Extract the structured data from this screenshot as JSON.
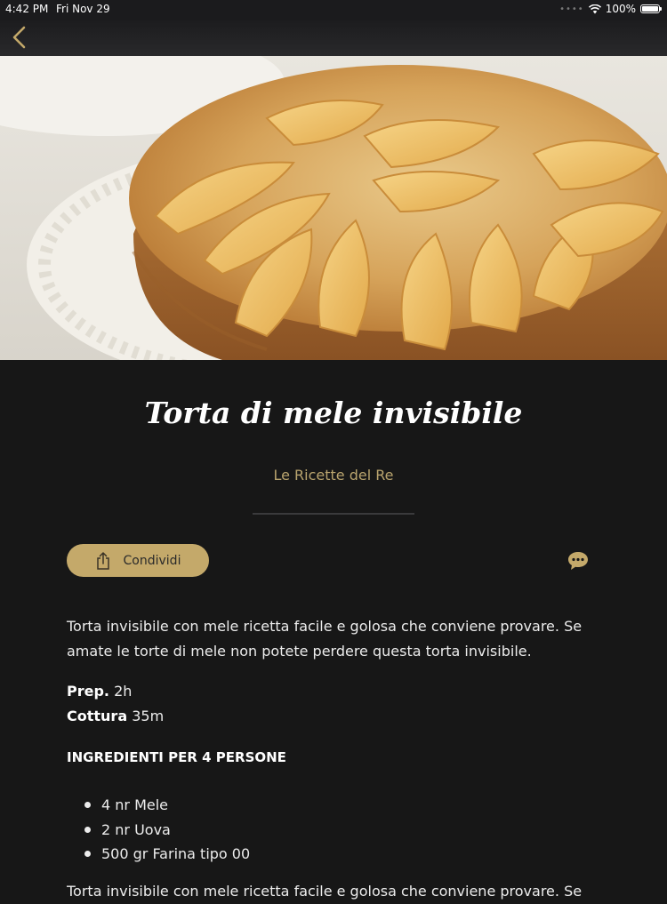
{
  "status_bar": {
    "time": "4:42 PM",
    "date": "Fri Nov 29",
    "battery": "100%",
    "icons": [
      "signal-dots-icon",
      "wifi-icon",
      "battery-icon"
    ]
  },
  "nav": {
    "back_icon": "chevron-left-icon"
  },
  "hero_image": {
    "subject": "apple cake photo"
  },
  "recipe": {
    "title": "Torta di mele invisibile",
    "author": "Le Ricette del Re",
    "share_label": "Condividi",
    "share_icon": "share-icon",
    "comment_icon": "chat-bubble-icon",
    "description": "Torta invisibile con mele ricetta facile e golosa che conviene provare. Se amate le torte di mele non potete perdere questa torta invisibile.",
    "prep_label": "Prep.",
    "prep_value": "2h",
    "cook_label": "Cottura",
    "cook_value": "35m",
    "ingredients_heading": "INGREDIENTI PER 4 PERSONE",
    "ingredients": [
      "4 nr Mele",
      "2 nr Uova",
      "500 gr Farina tipo 00"
    ],
    "truncated_line": "Torta invisibile con mele ricetta facile e golosa che conviene provare. Se"
  },
  "colors": {
    "background": "#171717",
    "accent": "#c4a96a",
    "author": "#b9a46e"
  }
}
